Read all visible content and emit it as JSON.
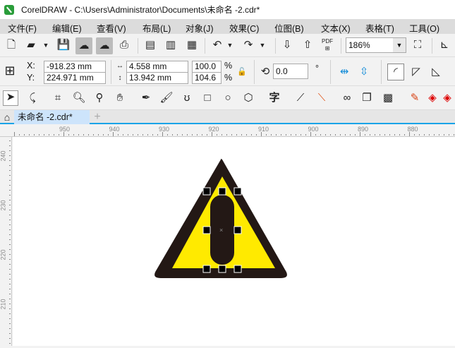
{
  "title": "CorelDRAW - C:\\Users\\Administrator\\Documents\\未命名 -2.cdr*",
  "menu": [
    "文件(F)",
    "编辑(E)",
    "查看(V)",
    "布局(L)",
    "对象(J)",
    "效果(C)",
    "位图(B)",
    "文本(X)",
    "表格(T)",
    "工具(O)"
  ],
  "toolbar": {
    "zoom": "186%",
    "pdf": "PDF"
  },
  "props": {
    "x_label": "X:",
    "y_label": "Y:",
    "x": "-918.23 mm",
    "y": "224.971 mm",
    "w": "4.558 mm",
    "h": "13.942 mm",
    "sx": "100.0",
    "sy": "104.6",
    "pct": "%",
    "rotation": "0.0",
    "deg": "°"
  },
  "tabs": {
    "doc": "未命名 -2.cdr*",
    "add": "+"
  },
  "ruler": {
    "h": [
      "950",
      "940",
      "930",
      "920",
      "910",
      "900",
      "890",
      "880"
    ],
    "v": [
      "240",
      "230",
      "220",
      "210"
    ]
  },
  "colors": {
    "yellow": "#ffea00",
    "dark": "#231815",
    "accent": "#1aa3e8"
  }
}
